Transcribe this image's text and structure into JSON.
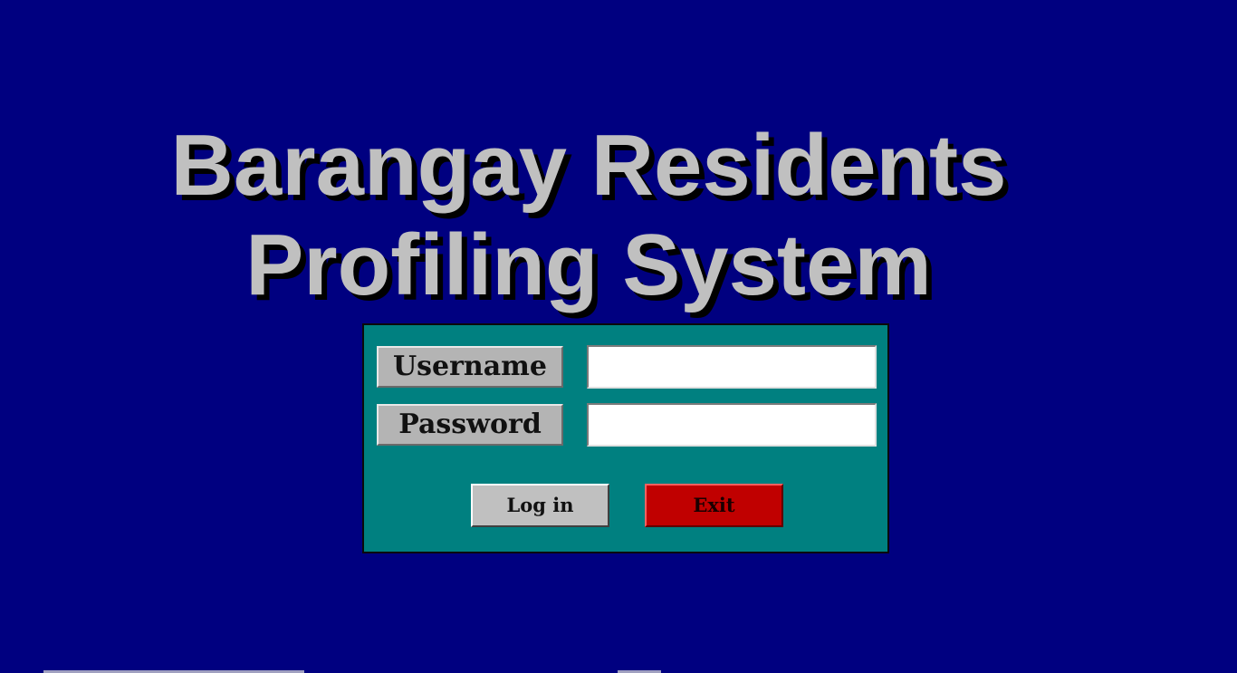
{
  "app": {
    "title_line1": "Barangay Residents",
    "title_line2": "Profiling System"
  },
  "login": {
    "username_label": "Username",
    "password_label": "Password",
    "username_value": "",
    "password_value": "",
    "login_button": "Log in",
    "exit_button": "Exit"
  },
  "colors": {
    "background": "#000080",
    "panel": "#008080",
    "title": "#c0c0c0",
    "exit_button": "#c00000"
  }
}
